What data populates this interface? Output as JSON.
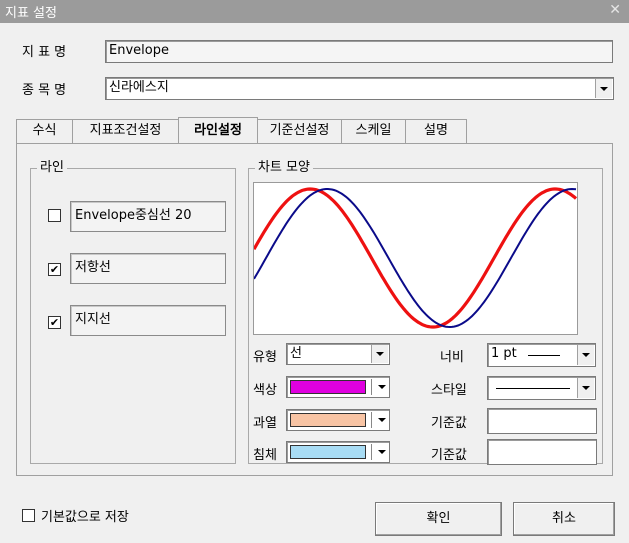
{
  "window": {
    "title": "지표 설정"
  },
  "fields": {
    "name_label": "지 표 명",
    "name_value": "Envelope",
    "symbol_label": "종 목 명",
    "symbol_value": "신라에스지"
  },
  "tabs": [
    {
      "label": "수식"
    },
    {
      "label": "지표조건설정"
    },
    {
      "label": "라인설정"
    },
    {
      "label": "기준선설정"
    },
    {
      "label": "스케일"
    },
    {
      "label": "설명"
    }
  ],
  "active_tab": "라인설정",
  "line_group": {
    "title": "라인",
    "items": [
      {
        "label": "Envelope중심선 20",
        "checked": false,
        "check_text": ""
      },
      {
        "label": "저항선",
        "checked": true,
        "check_text": "✔"
      },
      {
        "label": "지지선",
        "checked": true,
        "check_text": "✔"
      }
    ]
  },
  "chart_group": {
    "title": "차트 모양",
    "type_label": "유형",
    "type_value": "선",
    "width_label": "너비",
    "width_value": "1 pt",
    "color_label": "색상",
    "color_value": "#e000e0",
    "style_label": "스타일",
    "over_label": "과열",
    "over_color": "#f8c4a4",
    "base_label1": "기준값",
    "under_label": "침체",
    "under_color": "#a8dcf4",
    "base_label2": "기준값"
  },
  "preview_colors": {
    "red_line": "#ee1111",
    "blue_line": "#0b0b8a"
  },
  "footer": {
    "save_default_label": "기본값으로 저장",
    "ok_label": "확인",
    "cancel_label": "취소"
  }
}
